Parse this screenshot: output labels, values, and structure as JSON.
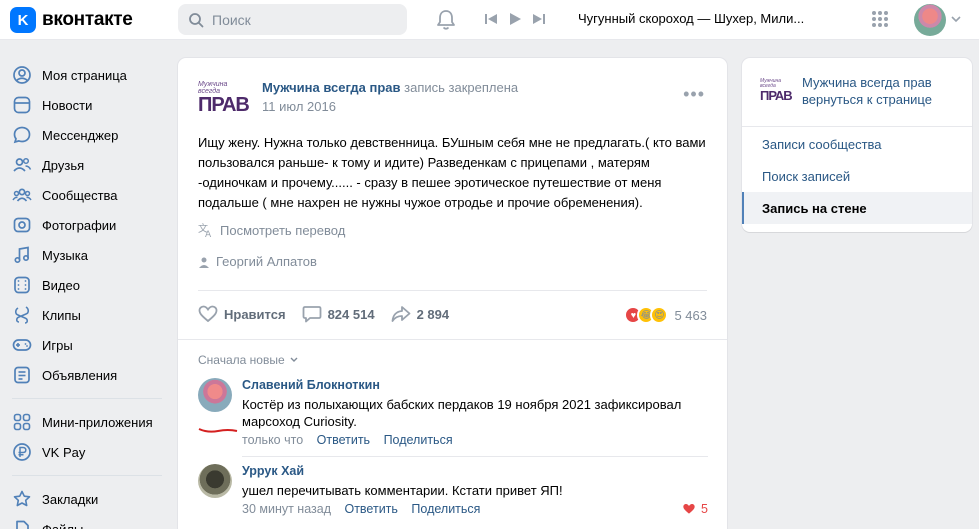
{
  "header": {
    "logo_letter": "K",
    "logo_text": "вконтакте",
    "search_placeholder": "Поиск",
    "track": "Чугунный скороход — Шухер, Мили..."
  },
  "nav": {
    "items": [
      {
        "label": "Моя страница",
        "icon": "user-circle-icon"
      },
      {
        "label": "Новости",
        "icon": "news-icon"
      },
      {
        "label": "Мессенджер",
        "icon": "chat-icon"
      },
      {
        "label": "Друзья",
        "icon": "friends-icon"
      },
      {
        "label": "Сообщества",
        "icon": "groups-icon"
      },
      {
        "label": "Фотографии",
        "icon": "photo-icon"
      },
      {
        "label": "Музыка",
        "icon": "music-icon"
      },
      {
        "label": "Видео",
        "icon": "video-icon"
      },
      {
        "label": "Клипы",
        "icon": "clips-icon"
      },
      {
        "label": "Игры",
        "icon": "gamepad-icon"
      },
      {
        "label": "Объявления",
        "icon": "ads-icon"
      }
    ],
    "items2": [
      {
        "label": "Мини-приложения",
        "icon": "apps-icon"
      },
      {
        "label": "VK Pay",
        "icon": "ruble-icon"
      }
    ],
    "items3": [
      {
        "label": "Закладки",
        "icon": "bookmark-icon"
      },
      {
        "label": "Файлы",
        "icon": "file-icon"
      }
    ]
  },
  "post": {
    "group_logo_top": "Мужчина всегда",
    "group_logo_bottom": "ПРАВ",
    "author": "Мужчина всегда прав",
    "pinned": "запись закреплена",
    "date": "11 июл 2016",
    "text": "Ищу жену. Нужна только девственница. БУшным себя мне не предлагать.( кто вами пользовался раньше- к тому и идите) Разведенкам с прицепами , матерям -одиночкам и прочему...... - сразу в пешее эротическое путешествие от меня подальше ( мне нахрен не нужны чужое отродье и прочие обременения).",
    "translate": "Посмотреть перевод",
    "signer": "Георгий Алпатов",
    "like_label": "Нравится",
    "comments_count": "824 514",
    "shares_count": "2 894",
    "reactions_count": "5 463",
    "sort_label": "Сначала новые"
  },
  "comments": [
    {
      "name": "Славений Блокноткин",
      "text": "Костёр из полыхающих бабских пердаков 19 ноября 2021 зафиксировал марсоход Curiosity.",
      "time": "только что",
      "reply": "Ответить",
      "share": "Поделиться",
      "likes": ""
    },
    {
      "name": "Уррук Хай",
      "text": "ушел перечитывать комментарии. Кстати привет ЯП!",
      "time": "30 минут назад",
      "reply": "Ответить",
      "share": "Поделиться",
      "likes": "5"
    }
  ],
  "right_panel": {
    "group_name": "Мужчина всегда прав",
    "back": "вернуться к странице",
    "items": [
      "Записи сообщества",
      "Поиск записей",
      "Запись на стене"
    ],
    "active_index": 2
  },
  "colors": {
    "accent": "#0077ff",
    "link": "#2a5885",
    "muted": "#818c99",
    "like_red": "#e64646"
  }
}
